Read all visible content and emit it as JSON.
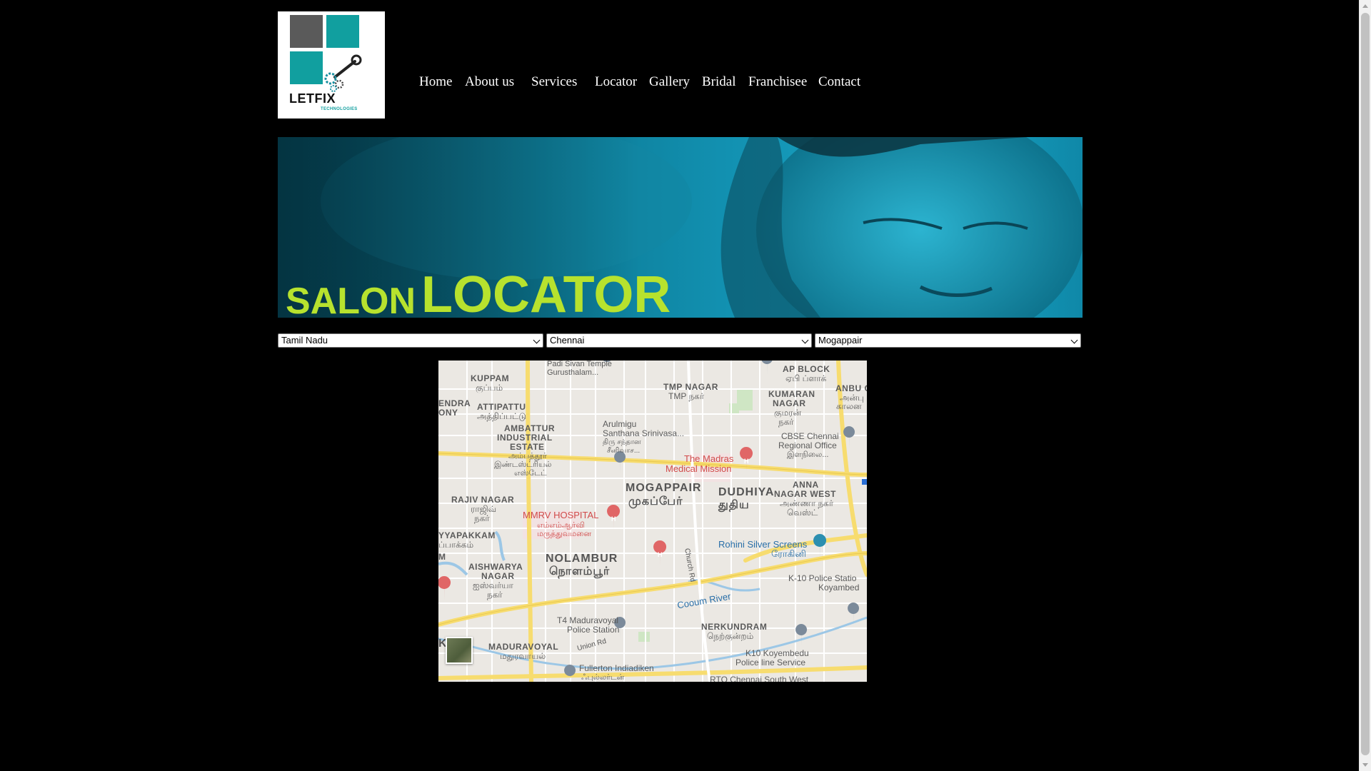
{
  "logo": {
    "brand": "LETFIX",
    "sub": "TECHNOLOGIES"
  },
  "nav": [
    {
      "label": "Home"
    },
    {
      "label": "About us"
    },
    {
      "label": "Services"
    },
    {
      "label": "Locator"
    },
    {
      "label": "Gallery"
    },
    {
      "label": "Bridal"
    },
    {
      "label": "Franchisee"
    },
    {
      "label": "Contact"
    }
  ],
  "banner": {
    "title_small": "SALON",
    "title_large": "LOCATOR"
  },
  "filters": {
    "state": "Tamil Nadu",
    "city": "Chennai",
    "area": "Mogappair"
  },
  "map": {
    "labels": {
      "kuppam": "KUPPAM",
      "kuppam_ta": "குப்பம்",
      "padi": "Padi Sivan Temple",
      "padi2": "Gurusthalam...",
      "tmp": "TMP NAGAR",
      "tmp_ta": "TMP நகர்",
      "ap": "AP BLOCK",
      "ap_ta": "ஏபி ப்ளாக்",
      "kumaran": "KUMARAN",
      "kumaran2": "NAGAR",
      "kumaran_ta": "குமரன்",
      "kumaran_ta2": "நகர்",
      "anbu": "ANBU COL",
      "anbu_ta": "அன்பு",
      "anbu_ta2": "காலன",
      "endra": "ENDRA",
      "ony": "ONY",
      "attipattu": "ATTIPATTU",
      "attipattu_ta": "அத்திப்பட்டு",
      "arulmigu": "Arulmigu",
      "santhana": "Santhana Srinivasa...",
      "santhana_ta": "திரு சந்தான",
      "santhana_ta2": "சீனிவாச...",
      "ambattur": "AMBATTUR",
      "industrial": "INDUSTRIAL",
      "estate": "ESTATE",
      "ambattur_ta": "அம்பத்தூர்",
      "ambattur_ta2": "இண்டஸ்ட்ரியல்",
      "ambattur_ta3": "எஸ்டேட்",
      "cbse": "CBSE Chennai",
      "cbse2": "Regional Office",
      "cbse_ta": "இளநிலை...",
      "madras": "The Madras",
      "madras2": "Medical Mission",
      "mogappair": "MOGAPPAIR",
      "mogappair_ta": "முகப்பேர்",
      "dudhiya": "DUDHIYA",
      "dudhiya_ta": "துதிய",
      "anna": "ANNA",
      "anna2": "NAGAR WEST",
      "anna_ta": "அண்ணா நகர்",
      "anna_ta2": "வெஸ்ட்",
      "rajiv": "RAJIV NAGAR",
      "rajiv_ta": "ராஜிவ்",
      "rajiv_ta2": "நகர்",
      "mmrv": "MMRV HOSPITAL",
      "mmrv_ta": "எம்எம்ஆர்வி",
      "mmrv_ta2": "மருத்துவமனை",
      "yyapakkam": "YYAPAKKAM",
      "yyapakkam_ta": "ப்பாக்கம்",
      "rohini": "Rohini Silver Screens",
      "rohini_ta": "ரோகினி",
      "nolambur": "NOLAMBUR",
      "nolambur_ta": "நொளம்பூர்",
      "aishwarya": "AISHWARYA",
      "aishwarya2": "NAGAR",
      "aishwarya_ta": "ஐஸ்வர்யா",
      "aishwarya_ta2": "நகர்",
      "k10": "K-10 Police Statio",
      "koyambed": "Koyambed",
      "church": "Church Rd",
      "cooum": "Cooum River",
      "t4": "T4 Maduravoyal",
      "t4b": "Police Station",
      "nerkundram": "NERKUNDRAM",
      "nerkundram_ta": "நெற்குன்றம்",
      "union": "Union Rd",
      "maduravoyal": "MADURAVOYAL",
      "maduravoyal_ta": "மதுரவாயல்",
      "k10koyam": "K10 Koyembedu",
      "k10koyam2": "Police line Service",
      "fullerton": "Fullerton Indiadiken",
      "fullerton_ta": "ஃபுல்லர்டன்",
      "rto": "RTO Chennai South West",
      "k": "K",
      "m": "M"
    }
  }
}
